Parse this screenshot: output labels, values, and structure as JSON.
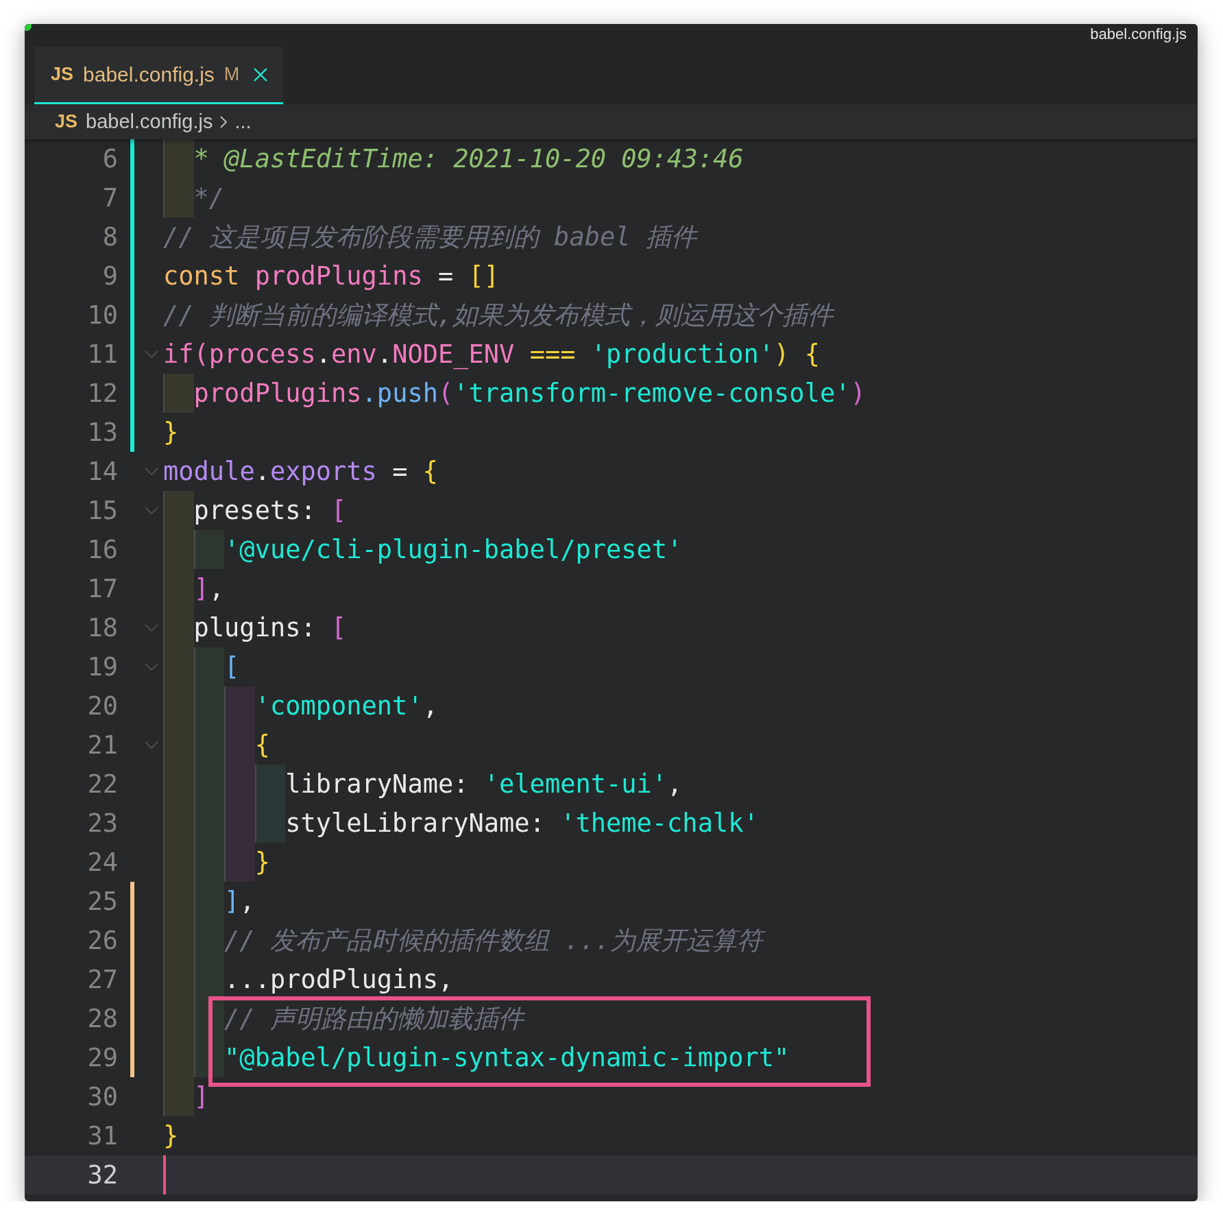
{
  "window": {
    "title": "babel.config.js"
  },
  "tab": {
    "file_icon": "JS",
    "label": "babel.config.js",
    "status": "M",
    "selected": true
  },
  "breadcrumb": {
    "file_icon": "JS",
    "items": [
      "babel.config.js",
      "..."
    ]
  },
  "editor": {
    "lines": [
      {
        "number": "6",
        "change_bar": {
          "color": "#1de9d4"
        },
        "guides": [
          {
            "color": "#38392c"
          }
        ],
        "tokens": [
          {
            "kind": "doc",
            "text": "* @LastEditTime: 2021-10-20 09:43:46"
          }
        ]
      },
      {
        "number": "7",
        "change_bar": {
          "color": "#1de9d4"
        },
        "guides": [
          {
            "color": "#38392c"
          }
        ],
        "tokens": [
          {
            "kind": "comment",
            "text": "*/"
          }
        ]
      },
      {
        "number": "8",
        "change_bar": {
          "color": "#1de9d4"
        },
        "tokens": [
          {
            "kind": "comment",
            "text": "// 这是项目发布阶段需要用到的 babel 插件"
          }
        ]
      },
      {
        "number": "9",
        "change_bar": {
          "color": "#1de9d4"
        },
        "tokens": [
          {
            "kind": "keyword",
            "text": "const "
          },
          {
            "kind": "variable",
            "text": "prodPlugins"
          },
          {
            "kind": "plain",
            "text": " = "
          },
          {
            "kind": "brace",
            "text": "[]"
          }
        ]
      },
      {
        "number": "10",
        "change_bar": {
          "color": "#1de9d4"
        },
        "tokens": [
          {
            "kind": "comment",
            "text": "// 判断当前的编译模式,如果为发布模式，则运用这个插件"
          }
        ]
      },
      {
        "number": "11",
        "change_bar": {
          "color": "#1de9d4"
        },
        "foldable": true,
        "tokens": [
          {
            "kind": "variable",
            "text": "if("
          },
          {
            "kind": "variable",
            "text": "process"
          },
          {
            "kind": "plain",
            "text": "."
          },
          {
            "kind": "variable",
            "text": "env"
          },
          {
            "kind": "plain",
            "text": "."
          },
          {
            "kind": "variable",
            "text": "NODE_ENV"
          },
          {
            "kind": "brace",
            "text": " === "
          },
          {
            "kind": "string",
            "text": "'production'"
          },
          {
            "kind": "brace",
            "text": ") {"
          }
        ]
      },
      {
        "number": "12",
        "change_bar": {
          "color": "#1de9d4"
        },
        "guides": [
          {
            "color": "#38392c"
          }
        ],
        "tokens": [
          {
            "kind": "variable",
            "text": "prodPlugins"
          },
          {
            "kind": "method",
            "text": ".push"
          },
          {
            "kind": "bracket",
            "text": "("
          },
          {
            "kind": "string",
            "text": "'transform-remove-console'"
          },
          {
            "kind": "bracket",
            "text": ")"
          }
        ]
      },
      {
        "number": "13",
        "change_bar": {
          "color": "#1de9d4"
        },
        "tokens": [
          {
            "kind": "brace",
            "text": "}"
          }
        ]
      },
      {
        "number": "14",
        "foldable": true,
        "tokens": [
          {
            "kind": "object",
            "text": "module"
          },
          {
            "kind": "plain",
            "text": "."
          },
          {
            "kind": "object",
            "text": "exports"
          },
          {
            "kind": "plain",
            "text": " = "
          },
          {
            "kind": "brace",
            "text": "{"
          }
        ]
      },
      {
        "number": "15",
        "foldable": true,
        "guides": [
          {
            "color": "#38392c"
          }
        ],
        "tokens": [
          {
            "kind": "plain",
            "text": "presets: "
          },
          {
            "kind": "bracket",
            "text": "["
          }
        ]
      },
      {
        "number": "16",
        "guides": [
          {
            "color": "#38392c"
          },
          {
            "color": "#2e372f"
          }
        ],
        "tokens": [
          {
            "kind": "string",
            "text": "'@vue/cli-plugin-babel/preset'"
          }
        ]
      },
      {
        "number": "17",
        "guides": [
          {
            "color": "#38392c"
          }
        ],
        "tokens": [
          {
            "kind": "bracket",
            "text": "]"
          },
          {
            "kind": "plain",
            "text": ","
          }
        ]
      },
      {
        "number": "18",
        "foldable": true,
        "guides": [
          {
            "color": "#38392c"
          }
        ],
        "tokens": [
          {
            "kind": "plain",
            "text": "plugins: "
          },
          {
            "kind": "bracket",
            "text": "["
          }
        ]
      },
      {
        "number": "19",
        "foldable": true,
        "guides": [
          {
            "color": "#38392c"
          },
          {
            "color": "#2e372f"
          }
        ],
        "tokens": [
          {
            "kind": "square",
            "text": "["
          }
        ]
      },
      {
        "number": "20",
        "guides": [
          {
            "color": "#38392c"
          },
          {
            "color": "#2e372f"
          },
          {
            "color": "#372c3a"
          }
        ],
        "tokens": [
          {
            "kind": "string",
            "text": "'component'"
          },
          {
            "kind": "plain",
            "text": ","
          }
        ]
      },
      {
        "number": "21",
        "foldable": true,
        "guides": [
          {
            "color": "#38392c"
          },
          {
            "color": "#2e372f"
          },
          {
            "color": "#372c3a"
          }
        ],
        "tokens": [
          {
            "kind": "brace",
            "text": "{"
          }
        ]
      },
      {
        "number": "22",
        "guides": [
          {
            "color": "#38392c"
          },
          {
            "color": "#2e372f"
          },
          {
            "color": "#372c3a"
          },
          {
            "color": "#2b3636"
          }
        ],
        "tokens": [
          {
            "kind": "plain",
            "text": "libraryName: "
          },
          {
            "kind": "string",
            "text": "'element-ui'"
          },
          {
            "kind": "plain",
            "text": ","
          }
        ]
      },
      {
        "number": "23",
        "guides": [
          {
            "color": "#38392c"
          },
          {
            "color": "#2e372f"
          },
          {
            "color": "#372c3a"
          },
          {
            "color": "#2b3636"
          }
        ],
        "tokens": [
          {
            "kind": "plain",
            "text": "styleLibraryName: "
          },
          {
            "kind": "string",
            "text": "'theme-chalk'"
          }
        ]
      },
      {
        "number": "24",
        "guides": [
          {
            "color": "#38392c"
          },
          {
            "color": "#2e372f"
          },
          {
            "color": "#372c3a"
          }
        ],
        "tokens": [
          {
            "kind": "brace",
            "text": "}"
          }
        ]
      },
      {
        "number": "25",
        "change_bar": {
          "color": "#f3c48a"
        },
        "guides": [
          {
            "color": "#38392c"
          },
          {
            "color": "#2e372f"
          }
        ],
        "tokens": [
          {
            "kind": "square",
            "text": "]"
          },
          {
            "kind": "plain",
            "text": ","
          }
        ]
      },
      {
        "number": "26",
        "change_bar": {
          "color": "#f3c48a"
        },
        "guides": [
          {
            "color": "#38392c"
          },
          {
            "color": "#2e372f"
          }
        ],
        "tokens": [
          {
            "kind": "comment",
            "text": "// 发布产品时候的插件数组 ...为展开运算符"
          }
        ]
      },
      {
        "number": "27",
        "change_bar": {
          "color": "#f3c48a"
        },
        "guides": [
          {
            "color": "#38392c"
          },
          {
            "color": "#2e372f"
          }
        ],
        "tokens": [
          {
            "kind": "plain",
            "text": "...prodPlugins,"
          }
        ]
      },
      {
        "number": "28",
        "change_bar": {
          "color": "#f3c48a"
        },
        "highlighted": true,
        "guides": [
          {
            "color": "#38392c"
          },
          {
            "color": "#2e372f"
          }
        ],
        "tokens": [
          {
            "kind": "comment",
            "text": "// 声明路由的懒加载插件"
          }
        ]
      },
      {
        "number": "29",
        "change_bar": {
          "color": "#f3c48a"
        },
        "highlighted": true,
        "guides": [
          {
            "color": "#38392c"
          },
          {
            "color": "#2e372f"
          }
        ],
        "tokens": [
          {
            "kind": "string",
            "text": "\"@babel/plugin-syntax-dynamic-import\""
          }
        ]
      },
      {
        "number": "30",
        "guides": [
          {
            "color": "#38392c"
          }
        ],
        "tokens": [
          {
            "kind": "bracket",
            "text": "]"
          }
        ]
      },
      {
        "number": "31",
        "tokens": [
          {
            "kind": "brace",
            "text": "}"
          }
        ]
      },
      {
        "number": "32",
        "current": true
      }
    ]
  }
}
